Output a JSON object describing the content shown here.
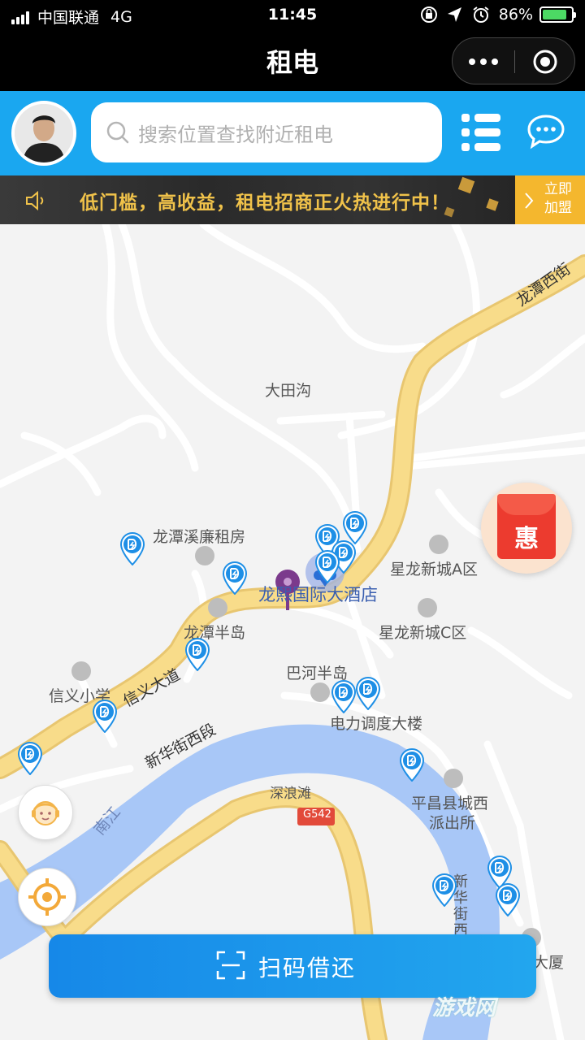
{
  "status_bar": {
    "carrier": "中国联通",
    "network": "4G",
    "time": "11:45",
    "battery_percent": "86%",
    "battery_level": 0.86,
    "icons": [
      "lock-rotation-icon",
      "location-arrow-icon",
      "alarm-icon"
    ]
  },
  "title_bar": {
    "title": "租电",
    "menu_icon": "more-dots-icon",
    "close_icon": "circle-target-icon"
  },
  "header": {
    "search_placeholder": "搜索位置查找附近租电",
    "list_icon": "list-icon",
    "chat_icon": "chat-bubble-icon"
  },
  "banner": {
    "text": "低门槛，高收益，租电招商正火热进行中！",
    "join_label": "立即加盟"
  },
  "map": {
    "roads": [
      "龙潭西街",
      "信义大道",
      "新华街西段",
      "G542",
      "南江",
      "新华街西"
    ],
    "places": [
      "大田沟",
      "龙潭溪廉租房",
      "星龙新城A区",
      "龙熙国际大酒店",
      "星龙新城C区",
      "龙潭半岛",
      "巴河半岛",
      "信义小学",
      "电力调度大楼",
      "深浪滩",
      "平昌县城西",
      "派出所",
      "大厦"
    ],
    "hongbao_label": "惠"
  },
  "actions": {
    "scan_label": "扫码借还",
    "service_icon": "customer-service-icon",
    "locate_icon": "locate-icon"
  },
  "watermark": "游戏网",
  "colors": {
    "header_blue": "#1aa7f0",
    "banner_gold": "#f0c24a",
    "road_yellow": "#f4d27a",
    "river_blue": "#a8c7f7",
    "station_blue": "#1e8fe6",
    "hongbao_red": "#ec3b2f"
  }
}
